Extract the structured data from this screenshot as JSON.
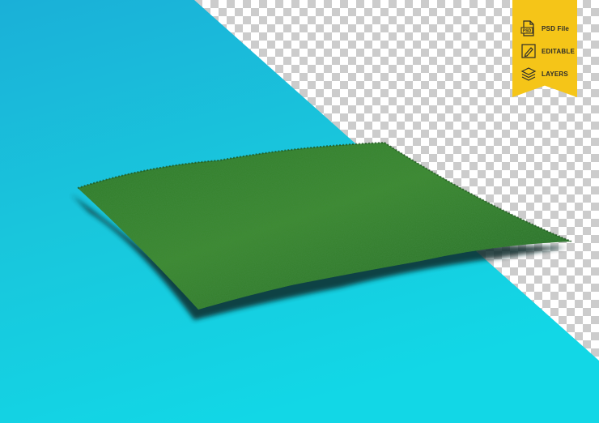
{
  "badge": {
    "color": "#f5c518",
    "items": [
      {
        "icon": "psd-file-icon",
        "label": "PSD File"
      },
      {
        "icon": "edit-icon",
        "label": "EDITABLE"
      },
      {
        "icon": "layers-icon",
        "label": "LAYERS"
      }
    ],
    "psd_icon_text": "PSD"
  },
  "colors": {
    "background_blue": "#19c6dc",
    "checker_light": "#ffffff",
    "checker_dark": "#cccccc",
    "grass_dark": "#1d5a1e",
    "grass_light": "#4f9a3a",
    "shadow": "#0a2a2a"
  }
}
